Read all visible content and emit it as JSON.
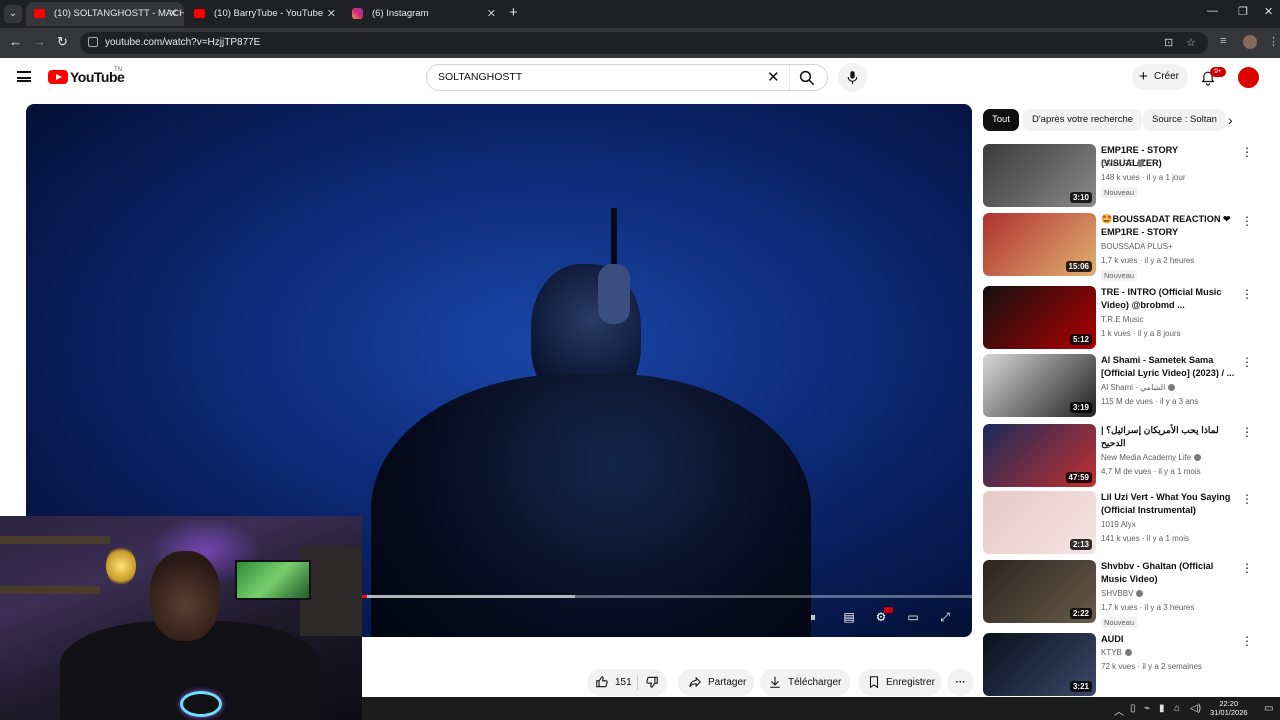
{
  "browser": {
    "tabs": [
      {
        "label": "(10) SOLTANGHOSTT - MACHE",
        "active": true
      },
      {
        "label": "(10) BarryTube - YouTube",
        "active": false
      },
      {
        "label": "(6) Instagram",
        "active": false
      }
    ],
    "url": "youtube.com/watch?v=HzjjTP877E"
  },
  "header": {
    "logo_text": "YouTube",
    "country_code": "TN",
    "search_value": "SOLTANGHOSTT",
    "create_label": "Créer",
    "notification_count": "9+"
  },
  "player": {
    "progress_fraction": 0.36,
    "loaded_fraction": 0.58
  },
  "actions": {
    "like_count": "151",
    "share_label": "Partager",
    "download_label": "Télécharger",
    "save_label": "Enregistrer"
  },
  "chips": [
    "Tout",
    "D'après votre recherche",
    "Source : Soltan"
  ],
  "recommendations": [
    {
      "title": "EMP1RE - STORY (VISUALIZER)",
      "channel": "EMP1RE",
      "verified": true,
      "meta": "148 k vues · il y a 1 jour",
      "badge": "Nouveau",
      "duration": "3:10",
      "thumb_colors": [
        "#3a3a3a",
        "#8a8a8a"
      ]
    },
    {
      "title": "🤩BOUSSADAT REACTION ❤ EMP1RE - STORY (VISUALIZER)",
      "channel": "BOUSSADA PLUS+",
      "verified": false,
      "meta": "1,7 k vues · il y a 2 heures",
      "badge": "Nouveau",
      "duration": "15:06",
      "thumb_colors": [
        "#b03030",
        "#e0b070"
      ]
    },
    {
      "title": "TRE - INTRO (Official Music Video) @brobmd ...",
      "channel": "T.R.E Music",
      "verified": false,
      "meta": "1 k vues · il y a 8 jours",
      "badge": "",
      "duration": "5:12",
      "thumb_colors": [
        "#111111",
        "#b00000"
      ]
    },
    {
      "title": "Al Shami - Sametek Sama [Official Lyric Video] (2023) / ...",
      "channel": "Al Shami - الشامي",
      "verified": true,
      "meta": "115 M de vues · il y a 3 ans",
      "badge": "",
      "duration": "3:19",
      "thumb_colors": [
        "#d8d8d8",
        "#202020"
      ]
    },
    {
      "title": "لماذا يحب الأمريكان إسرائيل؟ | الدحيح",
      "channel": "New Media Academy Life",
      "verified": true,
      "meta": "4,7 M de vues · il y a 1 mois",
      "badge": "",
      "duration": "47:59",
      "thumb_colors": [
        "#1a2a5a",
        "#c03030"
      ]
    },
    {
      "title": "Lil Uzi Vert - What You Saying (Official Instrumental)",
      "channel": "1019 Alyx",
      "verified": false,
      "meta": "141 k vues · il y a 1 mois",
      "badge": "",
      "duration": "2:13",
      "thumb_colors": [
        "#e8c8c8",
        "#f4e4e4"
      ]
    },
    {
      "title": "Shvbbv - Ghaltan (Official Music Video)",
      "channel": "SHVBBV",
      "verified": true,
      "meta": "1,7 k vues · il y a 3 heures",
      "badge": "Nouveau",
      "duration": "2:22",
      "thumb_colors": [
        "#2a2420",
        "#6a5a48"
      ]
    },
    {
      "title": "AUDI",
      "channel": "KTYB",
      "verified": true,
      "meta": "72 k vues · il y a 2 semaines",
      "badge": "",
      "duration": "3:21",
      "thumb_colors": [
        "#0a0f1a",
        "#3a4a6a"
      ]
    }
  ],
  "taskbar": {
    "time": "22:20",
    "date": "31/01/2026"
  }
}
